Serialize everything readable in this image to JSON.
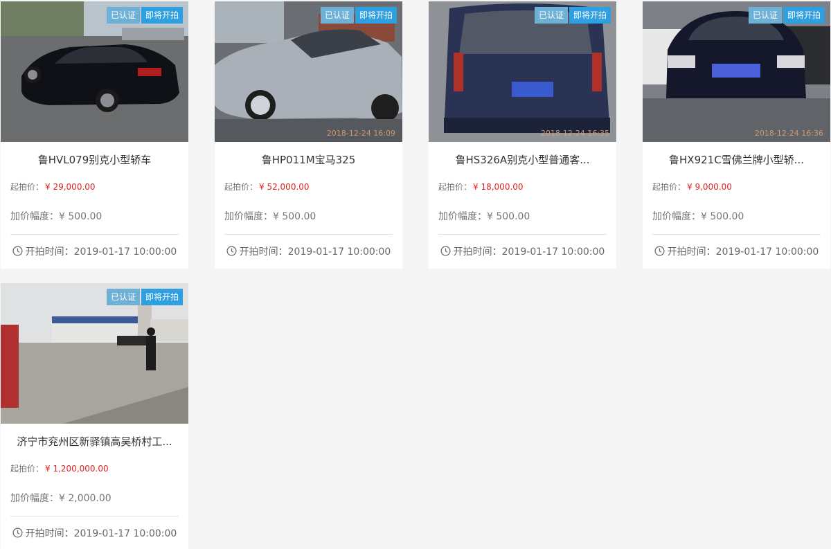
{
  "listings": [
    {
      "badge_certified": "已认证",
      "badge_status": "即将开拍",
      "stamp": "",
      "title": "鲁HVL079别克小型轿车",
      "start_price_label": "起拍价：",
      "start_price": "¥ 29,000.00",
      "increment_label": "加价幅度：",
      "increment": "¥ 500.00",
      "start_time_label": "开拍时间：",
      "start_time": "2019-01-17 10:00:00"
    },
    {
      "badge_certified": "已认证",
      "badge_status": "即将开拍",
      "stamp": "2018-12-24 16:09",
      "title": "鲁HP011M宝马325",
      "start_price_label": "起拍价：",
      "start_price": "¥ 52,000.00",
      "increment_label": "加价幅度：",
      "increment": "¥ 500.00",
      "start_time_label": "开拍时间：",
      "start_time": "2019-01-17 10:00:00"
    },
    {
      "badge_certified": "已认证",
      "badge_status": "即将开拍",
      "stamp": "2018-12-24 16:35",
      "title": "鲁HS326A别克小型普通客...",
      "start_price_label": "起拍价：",
      "start_price": "¥ 18,000.00",
      "increment_label": "加价幅度：",
      "increment": "¥ 500.00",
      "start_time_label": "开拍时间：",
      "start_time": "2019-01-17 10:00:00"
    },
    {
      "badge_certified": "已认证",
      "badge_status": "即将开拍",
      "stamp": "2018-12-24 16:36",
      "title": "鲁HX921C雪佛兰牌小型轿...",
      "start_price_label": "起拍价：",
      "start_price": "¥ 9,000.00",
      "increment_label": "加价幅度：",
      "increment": "¥ 500.00",
      "start_time_label": "开拍时间：",
      "start_time": "2019-01-17 10:00:00"
    },
    {
      "badge_certified": "已认证",
      "badge_status": "即将开拍",
      "stamp": "",
      "title": "济宁市兖州区新驿镇高吴桥村工...",
      "start_price_label": "起拍价：",
      "start_price": "¥ 1,200,000.00",
      "increment_label": "加价幅度：",
      "increment": "¥ 2,000.00",
      "start_time_label": "开拍时间：",
      "start_time": "2019-01-17 10:00:00"
    }
  ],
  "icons": {
    "clock": "clock-icon"
  },
  "colors": {
    "price": "#e02020",
    "badge_certified": "#6fb0d6",
    "badge_status": "#2e9fe0",
    "page_bg": "#f5f5f5"
  }
}
